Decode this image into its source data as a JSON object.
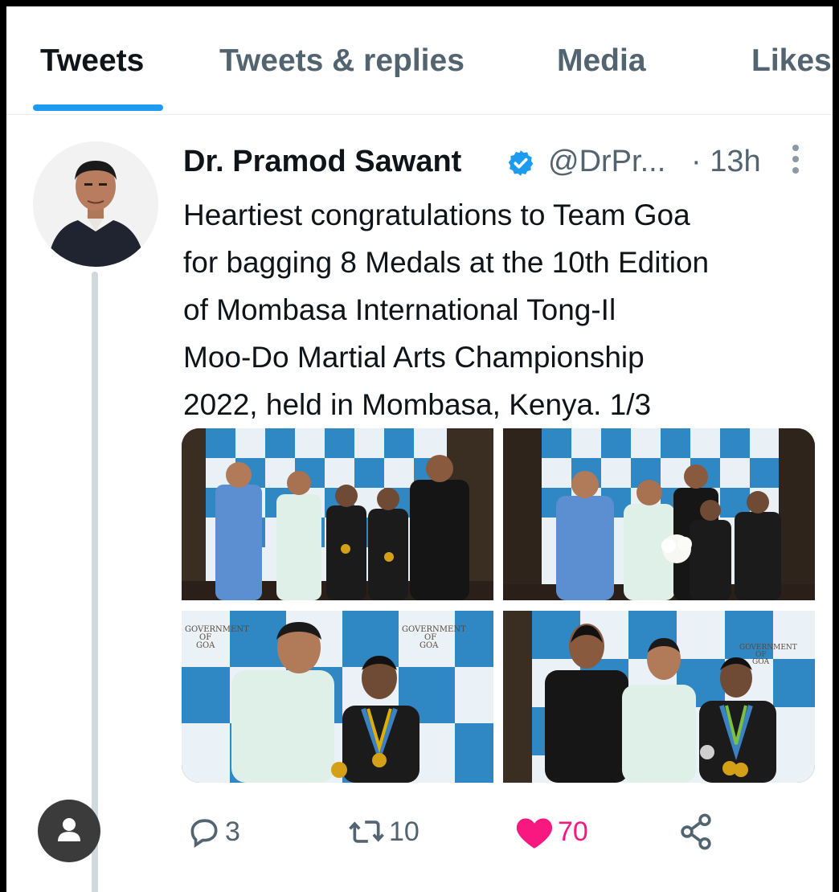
{
  "tabs": [
    {
      "label": "Tweets",
      "active": true
    },
    {
      "label": "Tweets & replies",
      "active": false
    },
    {
      "label": "Media",
      "active": false
    },
    {
      "label": "Likes",
      "active": false
    }
  ],
  "tweet": {
    "author_name": "Dr. Pramod Sawant",
    "handle": "@DrPr...",
    "time": "· 13h",
    "text_lines": [
      "Heartiest congratulations to Team Goa",
      "for bagging 8 Medals at the 10th Edition",
      "of Mombasa International Tong-Il",
      "Moo-Do Martial Arts Championship",
      "2022, held in Mombasa, Kenya. 1/3"
    ],
    "photos": [
      {
        "alt": "Group photo of Team Goa with medal winners"
      },
      {
        "alt": "Chief Minister presenting bouquet to athletes"
      },
      {
        "alt": "Chief Minister with a girl medal winner"
      },
      {
        "alt": "Chief Minister with a boy medal winner and coach"
      }
    ],
    "backdrop_text": [
      "GOVERNMENT",
      "OF",
      "GOA"
    ],
    "actions": {
      "replies": "3",
      "retweets": "10",
      "likes": "70"
    }
  },
  "colors": {
    "accent": "#1d9bf0",
    "like": "#f91880",
    "muted": "#536471",
    "text": "#0f1419"
  },
  "icons": [
    "verified-badge-icon",
    "more-vertical-icon",
    "reply-icon",
    "retweet-icon",
    "like-heart-icon",
    "share-icon",
    "default-user-icon"
  ]
}
